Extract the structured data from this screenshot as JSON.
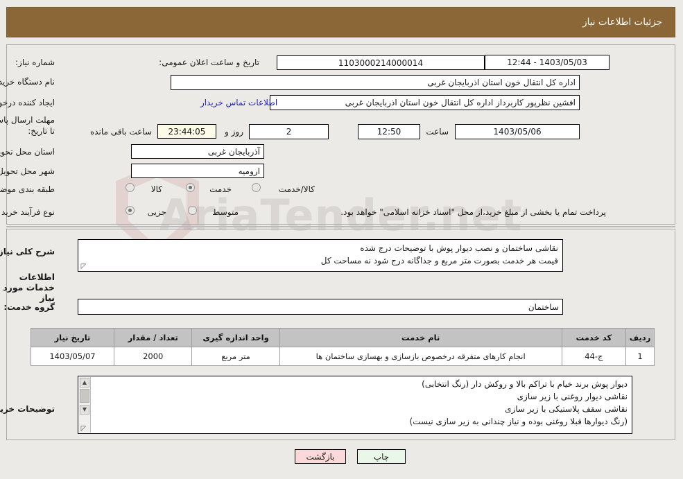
{
  "header": {
    "title": "جزئیات اطلاعات نیاز",
    "bg": "#8b6636"
  },
  "watermark": {
    "text": "AriaTender.net"
  },
  "top_section": {
    "need_number_label": "شماره نیاز:",
    "need_number_value": "1103000214000014",
    "announce_label": "تاریخ و ساعت اعلان عمومی:",
    "announce_value": "1403/05/03 - 12:44",
    "buyer_org_label": "نام دستگاه خریدار:",
    "buyer_org_value": "اداره کل انتقال خون استان اذربایجان غربی",
    "requester_label": "ایجاد کننده درخواست:",
    "requester_value": "افشین نظرپور کاربرداز اداره کل انتقال خون استان اذربایجان غربی",
    "contact_link": "اطلاعات تماس خریدار",
    "deadline_label": "مهلت ارسال پاسخ: تا تاریخ:",
    "deadline_date": "1403/05/06",
    "deadline_hour_label": "ساعت",
    "deadline_hour": "12:50",
    "days_remaining": "2",
    "days_unit_label": "روز و",
    "time_remaining": "23:44:05",
    "time_remaining_label": "ساعت باقی مانده",
    "province_label": "استان محل تحویل:",
    "province_value": "آذربایجان غربی",
    "city_label": "شهر محل تحویل:",
    "city_value": "ارومیه",
    "category_label": "طبقه بندی موضوعی:",
    "category_options": [
      {
        "label": "کالا",
        "selected": false
      },
      {
        "label": "خدمت",
        "selected": true
      },
      {
        "label": "کالا/خدمت",
        "selected": false
      }
    ],
    "process_label": "نوع فرآیند خرید :",
    "process_options": [
      {
        "label": "جزیی",
        "selected": true
      },
      {
        "label": "متوسط",
        "selected": false
      }
    ],
    "payment_note": "پرداخت تمام یا بخشی از مبلغ خرید،از محل \"اسناد خزانه اسلامی\" خواهد بود."
  },
  "mid_section": {
    "general_desc_label": "شرح کلی نیاز:",
    "general_desc_value": "نقاشی ساختمان و نصب دیوار پوش با توضیحات درج شده\nقیمت هر خدمت بصورت متر مربع و جداگانه درج شود نه مساحت کل",
    "services_heading": "اطلاعات خدمات مورد نیاز",
    "service_group_label": "گروه خدمت:",
    "service_group_value": "ساختمان",
    "table": {
      "columns": [
        "ردیف",
        "کد خدمت",
        "نام خدمت",
        "واحد اندازه گیری",
        "تعداد / مقدار",
        "تاریخ نیاز"
      ],
      "rows": [
        {
          "row": "1",
          "code": "ج-44",
          "name": "انجام کارهای متفرقه درخصوص بازسازی و بهسازی ساختمان ها",
          "unit": "متر مربع",
          "quantity": "2000",
          "date": "1403/05/07"
        }
      ]
    },
    "buyer_notes_label": "توضیحات خریدار:",
    "buyer_notes_value": "دیوار پوش برند خیام با تراکم بالا و روکش دار (رنگ انتخابی)\nنقاشی دیوار روغنی با زیر سازی\nنقاشی سقف پلاستیکی با زیر سازی\n(رنگ دیوارها قبلا روغنی بوده و نیاز چندانی به زیر سازی نیست)"
  },
  "footer": {
    "print_label": "چاپ",
    "back_label": "بازگشت"
  }
}
